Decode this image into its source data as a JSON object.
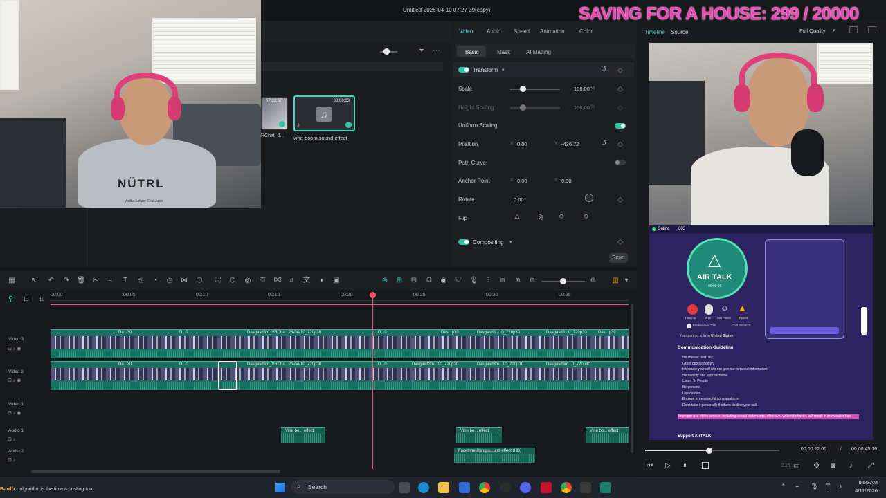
{
  "window": {
    "title": "Untitled-2026-04-10 07 27 39(copy)"
  },
  "overlay": {
    "banner": "SAVING FOR A HOUSE: 299 / 20000"
  },
  "webcam_shirt": {
    "brand": "NÜTRL",
    "line": "Vodka Seltzer Real Juice"
  },
  "media": {
    "clips": [
      {
        "name": "RChat_2...",
        "duration": "07:03:37"
      },
      {
        "name": "Vine boom sound effect",
        "duration": "00:00:03"
      }
    ]
  },
  "inspector": {
    "tabs": [
      "Video",
      "Audio",
      "Speed",
      "Animation",
      "Color"
    ],
    "subtabs": [
      "Basic",
      "Mask",
      "AI Matting"
    ],
    "transform_label": "Transform",
    "scale_label": "Scale",
    "scale_value": "100.00",
    "height_scaling_label": "Height Scaling",
    "height_scaling_value": "100.00",
    "unit": "%",
    "uniform_label": "Uniform Scaling",
    "position_label": "Position",
    "position_x": "0.00",
    "position_y": "-436.72",
    "path_curve_label": "Path Curve",
    "anchor_label": "Anchor Point",
    "anchor_x": "0.00",
    "anchor_y": "0.00",
    "rotate_label": "Rotate",
    "rotate_value": "0.00°",
    "flip_label": "Flip",
    "compositing_label": "Compositing",
    "reset_label": "Reset",
    "x": "X",
    "y": "Y"
  },
  "preview": {
    "tabs": [
      "Timeline",
      "Source"
    ],
    "quality": "Full Quality",
    "current_time": "00:00:22:05",
    "separator": "/",
    "total_time": "00:00:45:16",
    "ratio": "9:16"
  },
  "airtalk": {
    "online": "Online",
    "count": "683",
    "logo": "AIR TALK",
    "timer": "00:00:36",
    "actions": [
      "Hang up",
      "Mute",
      "Add Friend",
      "Report"
    ],
    "auto_call": "Enable Auto Call",
    "call_label": "Call 05/04/19",
    "from_prefix": "Your partner is from",
    "from_country": "United States",
    "guideline_title": "Communication Guideline",
    "guidelines": [
      "Be at least over 18 :)",
      "Greet people politely",
      "Introduce yourself (do not give our personal information)",
      "Be friendly and approachable",
      "Listen To People",
      "Be genuine",
      "Use caution",
      "Engage in meaningful conversations",
      "Don't take it personally if others decline your call."
    ],
    "warning": "Improper use of the service, including sexual statements, offensive, violent behavior, will result in irrevocable ban.",
    "support": "Support AirTALK"
  },
  "timeline": {
    "ruler": [
      "00:00",
      "00:05",
      "00:10",
      "00:15",
      "00:20",
      "00:25",
      "00:30",
      "00:35"
    ],
    "tracks": [
      "Video 3",
      "Video 2",
      "Video 1",
      "Audio 1",
      "Audio 2"
    ],
    "clip_labels_v3": [
      "Da...30",
      "D...0",
      "Dasgasd3m_VRCha...26-04-10_720p30",
      "D...0",
      "Das...p30",
      "Dasgasd3...10_720p30",
      "Dasgasd3...0_720p30",
      "Das...p30"
    ],
    "clip_labels_v2": [
      "Da...30",
      "D...0",
      "Dasgasd3m_VRCha...26-04-10_720p30",
      "D...0",
      "Dasgasd3m...10_720p30",
      "Dasgasd3m...10_720p30",
      "Dasgasd3m...0_720p30"
    ],
    "audio1_clips": [
      "Vine bo... effect",
      "Vine bo... effect",
      "Vine bo... effect"
    ],
    "audio2_clip": "Facetime Hang u...und effect (HD)"
  },
  "taskbar": {
    "search": "Search",
    "time": "8:55 AM",
    "date": "4/11/2026"
  },
  "chat": {
    "user": "Burdfx",
    "message": "algorithm is the time a posting too"
  },
  "colors": {
    "accent": "#3ddbc0",
    "playhead": "#ff4d6d",
    "banner": "#ff3fbf"
  }
}
